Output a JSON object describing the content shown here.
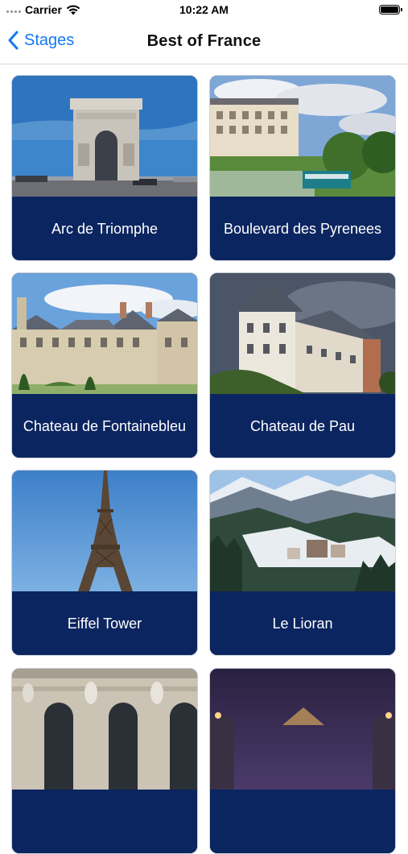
{
  "status_bar": {
    "carrier": "Carrier",
    "time": "10:22 AM"
  },
  "nav": {
    "back_label": "Stages",
    "title": "Best of France"
  },
  "colors": {
    "accent": "#1478f0",
    "card_label_bg": "#0b2560",
    "card_label_text": "#ffffff"
  },
  "cards": [
    {
      "label": "Arc de Triomphe"
    },
    {
      "label": "Boulevard des Pyrenees"
    },
    {
      "label": "Chateau de Fontainebleu"
    },
    {
      "label": "Chateau de Pau"
    },
    {
      "label": "Eiffel Tower"
    },
    {
      "label": "Le Lioran"
    },
    {
      "label": ""
    },
    {
      "label": ""
    }
  ]
}
